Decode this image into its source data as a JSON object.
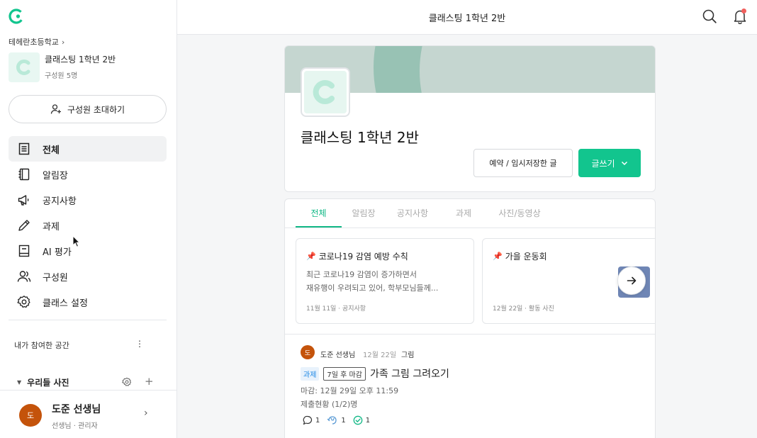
{
  "sidebar": {
    "school": "테헤란초등학교",
    "class_name": "클래스팅 1학년 2반",
    "members": "구성원 5명",
    "invite_label": "구성원 초대하기",
    "nav": [
      {
        "label": "전체",
        "icon": "document-icon",
        "active": true
      },
      {
        "label": "알림장",
        "icon": "notebook-icon",
        "active": false
      },
      {
        "label": "공지사항",
        "icon": "megaphone-icon",
        "active": false
      },
      {
        "label": "과제",
        "icon": "pencil-icon",
        "active": false
      },
      {
        "label": "AI 평가",
        "icon": "book-icon",
        "active": false
      },
      {
        "label": "구성원",
        "icon": "people-icon",
        "active": false
      },
      {
        "label": "클래스 설정",
        "icon": "gear-icon",
        "active": false
      }
    ],
    "my_space_label": "내가 참여한 공간",
    "photos_label": "우리들 사진",
    "profile": {
      "avatar_initial": "도",
      "name": "도준 선생님",
      "role": "선생님 · 관리자"
    }
  },
  "topbar": {
    "title": "클래스팅 1학년 2반"
  },
  "class_card": {
    "title": "클래스팅 1학년 2반",
    "reserve_label": "예약 / 임시저장한 글",
    "write_label": "글쓰기"
  },
  "feed": {
    "tabs": [
      "전체",
      "알림장",
      "공지사항",
      "과제",
      "사진/동영상"
    ],
    "active_tab": "전체",
    "notices": [
      {
        "title": "코로나19 감염 예방 수칙",
        "body_line1": "최근 코로나19 감염이 증가하면서",
        "body_line2": "재유행이 우려되고 있어, 학부모님들께...",
        "meta": "11월 11일 · 공지사항"
      },
      {
        "title": "가을 운동회",
        "body_line1": "",
        "body_line2": "",
        "meta": "12월 22일 · 활동 사진"
      }
    ],
    "post": {
      "avatar_initial": "도",
      "author": "도준 선생님",
      "date": "12월 22일",
      "category": "그림",
      "badge_task": "과제",
      "badge_due": "7일 후 마감",
      "title": "가족 그림 그려오기",
      "deadline": "마감: 12월 29일 오후 11:59",
      "status": "제출현황 (1/2)명",
      "comments": "1",
      "reactions": "1",
      "checks": "1"
    }
  },
  "colors": {
    "brand": "#12c58e",
    "accent_tab": "#12b886",
    "avatar": "#c4530b",
    "notification": "#f0605d"
  }
}
